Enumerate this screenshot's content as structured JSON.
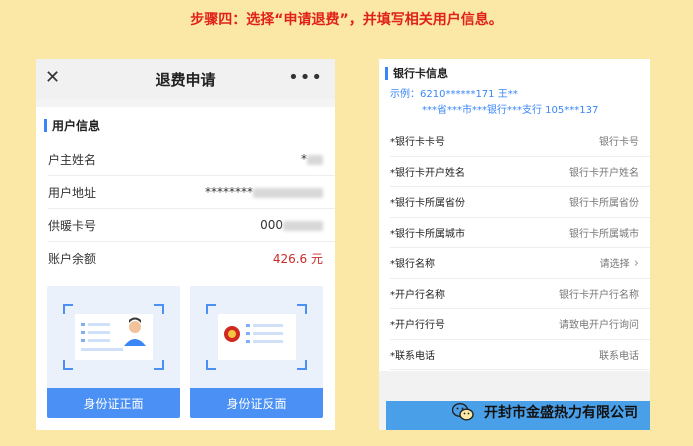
{
  "step_title": "步骤四：选择“申请退费”，并填写相关用户信息。",
  "left": {
    "title": "退费申请",
    "section": "用户信息",
    "rows": [
      {
        "label": "户主姓名",
        "value": "*",
        "blur_width": 16
      },
      {
        "label": "用户地址",
        "value": "********",
        "blur_width": 70
      },
      {
        "label": "供暖卡号",
        "value": "000",
        "blur_width": 40
      },
      {
        "label": "账户余额",
        "value": "426.6 元",
        "blur_width": 0
      }
    ],
    "id_front": "身份证正面",
    "id_back": "身份证反面"
  },
  "right": {
    "section": "银行卡信息",
    "example_line1": "示例：6210******171     王**",
    "example_line2": "***省***市***银行***支行   105***137",
    "rows": [
      {
        "label": "*银行卡卡号",
        "value": "银行卡号"
      },
      {
        "label": "*银行卡开户姓名",
        "value": "银行卡开户姓名"
      },
      {
        "label": "*银行卡所属省份",
        "value": "银行卡所属省份"
      },
      {
        "label": "*银行卡所属城市",
        "value": "银行卡所属城市"
      },
      {
        "label": "*银行名称",
        "value": "请选择"
      },
      {
        "label": "*开户行名称",
        "value": "银行卡开户行名称"
      },
      {
        "label": "*开户行行号",
        "value": "请致电开户行询问"
      },
      {
        "label": "*联系电话",
        "value": "联系电话"
      }
    ]
  },
  "watermark": "开封市金盛热力有限公司",
  "colors": {
    "accent": "#4a90f5",
    "background": "#fbe8a6",
    "step_title": "#e0211b",
    "balance": "#c92a2a"
  }
}
